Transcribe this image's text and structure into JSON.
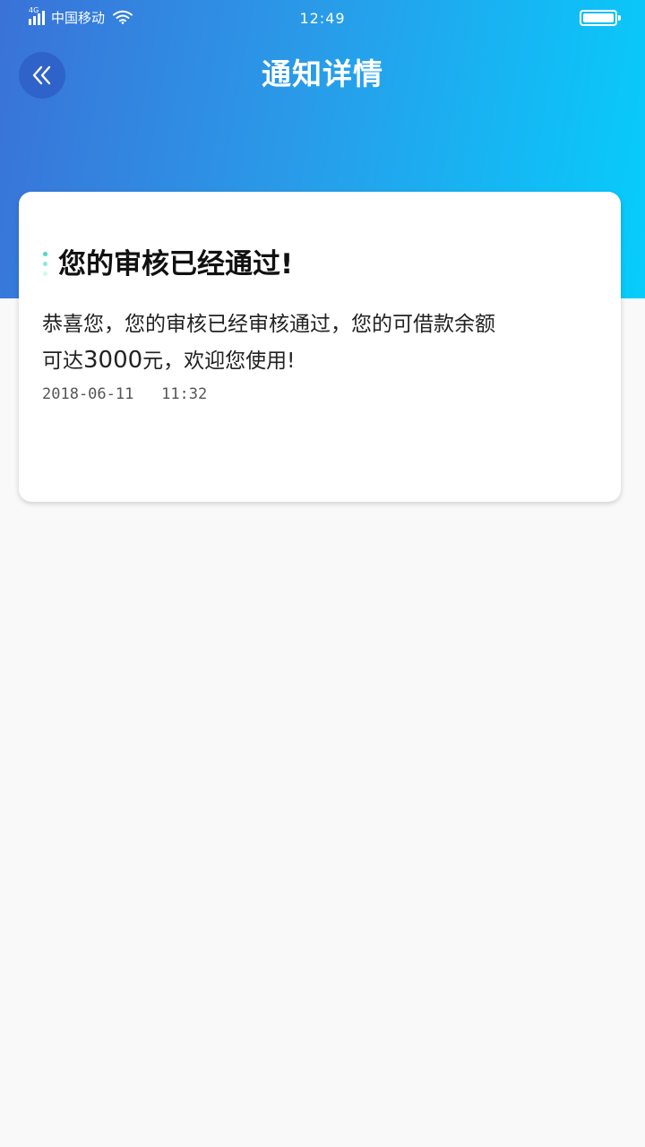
{
  "status_bar": {
    "network_type": "4G",
    "carrier": "中国移动",
    "time": "12:49"
  },
  "nav": {
    "back_icon": "double-chevron-left-icon",
    "title": "通知详情"
  },
  "notification": {
    "title": "您的审核已经通过!",
    "body_line1": "恭喜您，您的审核已经审核通过，您的可借款余额",
    "body_line2_prefix": "可达",
    "amount": "3000",
    "body_line2_suffix": "元，欢迎您使用!",
    "date": "2018-06-11",
    "time": "11:32"
  },
  "colors": {
    "header_gradient_start": "#3a72d8",
    "header_gradient_end": "#06cdfc",
    "back_button_bg": "#2f63c9",
    "marker_colors": [
      "#4fd8c4",
      "#8fe8dc",
      "#d4f6f1"
    ],
    "page_bg": "#f9f9f9",
    "card_bg": "#ffffff"
  }
}
